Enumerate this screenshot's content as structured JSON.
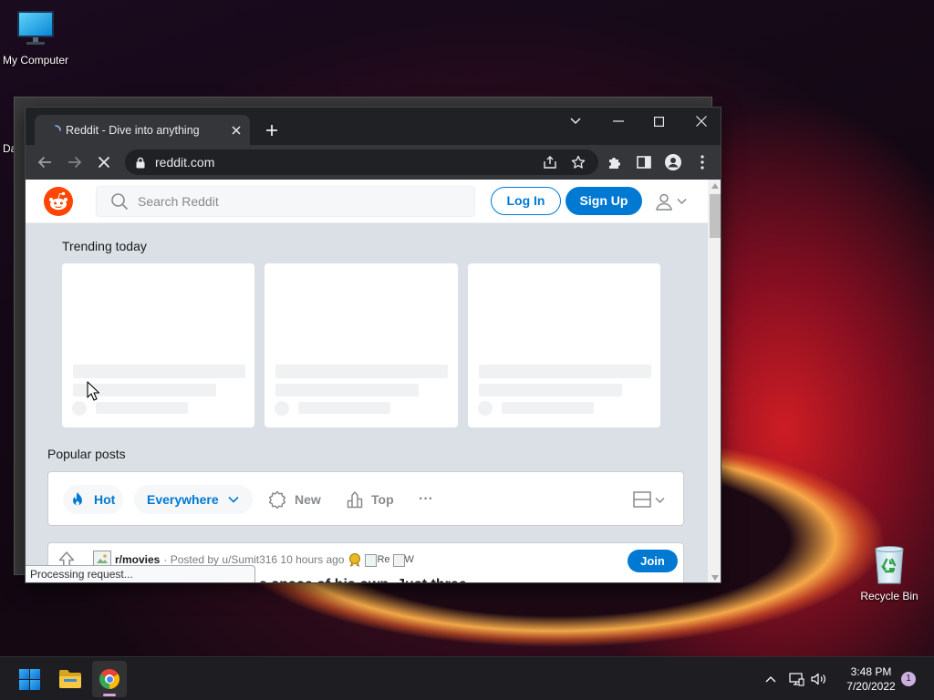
{
  "desktop": {
    "my_computer_label": "My Computer",
    "recycle_bin_label": "Recycle Bin",
    "partial_label": "Da"
  },
  "browser": {
    "tab_title": "Reddit - Dive into anything",
    "url": "reddit.com",
    "status": "Processing request..."
  },
  "page": {
    "search_placeholder": "Search Reddit",
    "login": "Log In",
    "signup": "Sign Up",
    "trending_title": "Trending today",
    "popular_title": "Popular posts",
    "sort": {
      "hot": "Hot",
      "everywhere": "Everywhere",
      "new": "New",
      "top": "Top",
      "more": "···"
    },
    "post": {
      "subreddit": "r/movies",
      "meta": "· Posted by u/Sumit316 10 hours ago",
      "award_alt_1": "Re",
      "award_alt_2": "W",
      "join": "Join",
      "title": "a space of his own. Just three"
    }
  },
  "taskbar": {
    "time": "3:48 PM",
    "date": "7/20/2022",
    "notification_count": "1"
  },
  "colors": {
    "reddit_blue": "#0079d3",
    "reddit_orange": "#ff4500",
    "chrome_frame": "#202124",
    "chrome_toolbar": "#35363a"
  },
  "icons": {
    "desktop": [
      "monitor-icon",
      "recycle-bin-icon"
    ],
    "chrome": [
      "loading-spinner-icon",
      "close-icon",
      "plus-icon",
      "chevron-down-icon",
      "minimize-icon",
      "maximize-icon",
      "back-arrow-icon",
      "forward-arrow-icon",
      "stop-icon",
      "lock-icon",
      "share-icon",
      "star-icon",
      "puzzle-icon",
      "side-panel-icon",
      "profile-icon",
      "kebab-menu-icon"
    ],
    "reddit": [
      "reddit-logo-icon",
      "search-icon",
      "user-icon",
      "flame-icon",
      "burst-icon",
      "top-chart-icon",
      "card-layout-icon",
      "upvote-icon",
      "award-icon"
    ],
    "taskbar": [
      "windows-start-icon",
      "folder-icon",
      "chrome-icon",
      "chevron-up-icon",
      "network-icon",
      "volume-icon"
    ]
  }
}
